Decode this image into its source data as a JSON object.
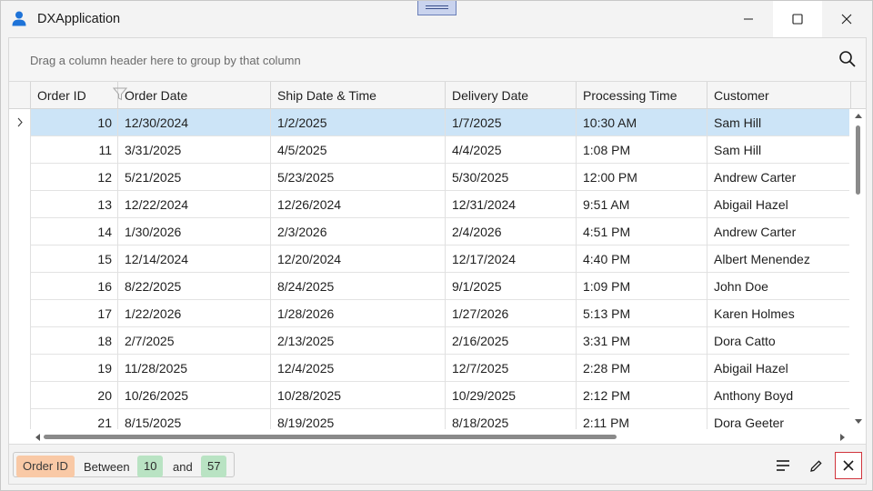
{
  "window": {
    "title": "DXApplication"
  },
  "grid": {
    "group_panel_text": "Drag a column header here to group by that column",
    "columns": [
      "Order ID",
      "Order Date",
      "Ship Date & Time",
      "Delivery Date",
      "Processing Time",
      "Customer"
    ],
    "rows": [
      [
        "10",
        "12/30/2024",
        "1/2/2025",
        "1/7/2025",
        "10:30 AM",
        "Sam Hill"
      ],
      [
        "11",
        "3/31/2025",
        "4/5/2025",
        "4/4/2025",
        "1:08 PM",
        "Sam Hill"
      ],
      [
        "12",
        "5/21/2025",
        "5/23/2025",
        "5/30/2025",
        "12:00 PM",
        "Andrew Carter"
      ],
      [
        "13",
        "12/22/2024",
        "12/26/2024",
        "12/31/2024",
        "9:51 AM",
        "Abigail Hazel"
      ],
      [
        "14",
        "1/30/2026",
        "2/3/2026",
        "2/4/2026",
        "4:51 PM",
        "Andrew Carter"
      ],
      [
        "15",
        "12/14/2024",
        "12/20/2024",
        "12/17/2024",
        "4:40 PM",
        "Albert Menendez"
      ],
      [
        "16",
        "8/22/2025",
        "8/24/2025",
        "9/1/2025",
        "1:09 PM",
        "John Doe"
      ],
      [
        "17",
        "1/22/2026",
        "1/28/2026",
        "1/27/2026",
        "5:13 PM",
        "Karen Holmes"
      ],
      [
        "18",
        "2/7/2025",
        "2/13/2025",
        "2/16/2025",
        "3:31 PM",
        "Dora Catto"
      ],
      [
        "19",
        "11/28/2025",
        "12/4/2025",
        "12/7/2025",
        "2:28 PM",
        "Abigail Hazel"
      ],
      [
        "20",
        "10/26/2025",
        "10/28/2025",
        "10/29/2025",
        "2:12 PM",
        "Anthony Boyd"
      ],
      [
        "21",
        "8/15/2025",
        "8/19/2025",
        "8/18/2025",
        "2:11 PM",
        "Dora Geeter"
      ]
    ],
    "selected_row": 0
  },
  "filter": {
    "field": "Order ID",
    "operator": "Between",
    "value_from": "10",
    "conjunction": "and",
    "value_to": "57"
  },
  "icons": {
    "app": "user-icon",
    "search": "search-icon",
    "filter": "funnel-icon",
    "align": "align-left-icon",
    "edit": "pencil-icon",
    "clear": "close-icon"
  },
  "colors": {
    "selection": "#cce4f7",
    "field_pill": "#f9c9a6",
    "value_pill": "#b9e3c3",
    "clear_border": "#d1343c",
    "app_icon": "#1e73d8"
  }
}
